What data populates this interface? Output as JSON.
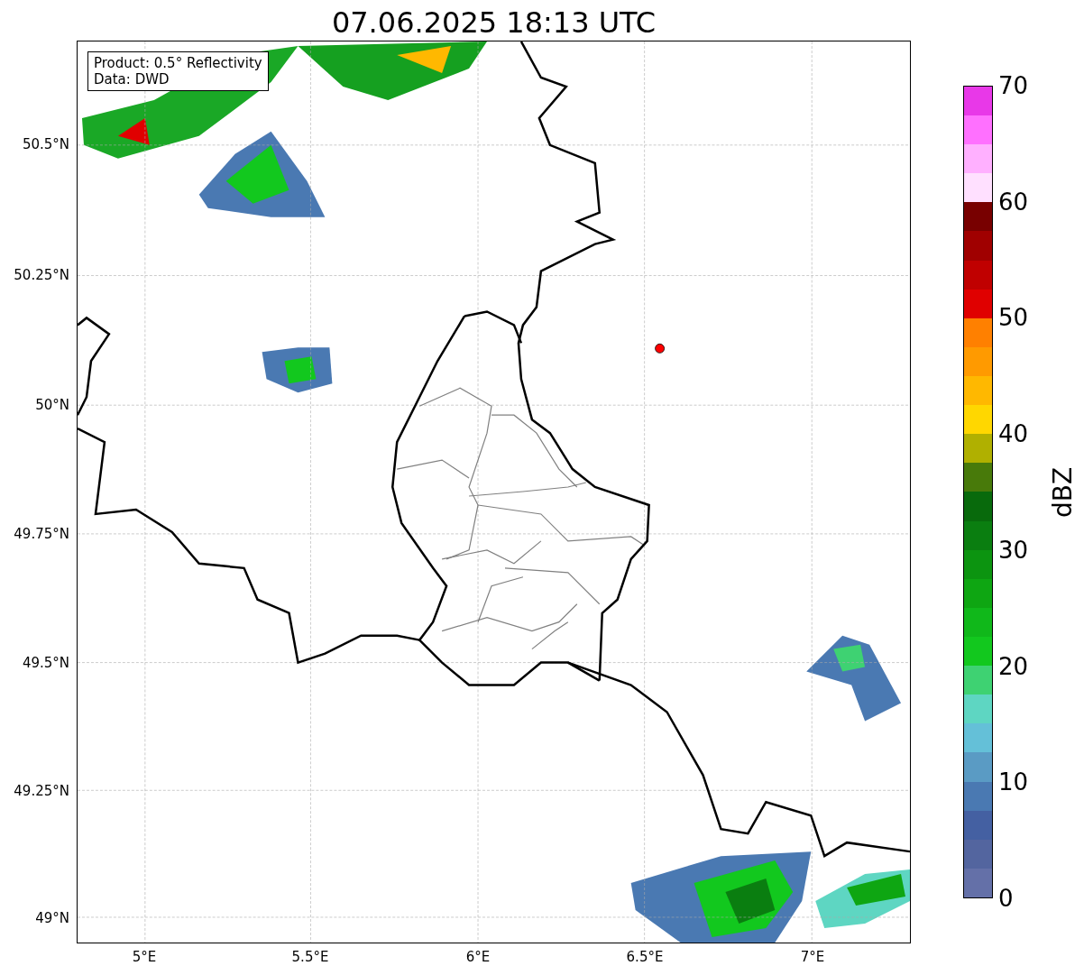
{
  "title": "07.06.2025 18:13 UTC",
  "legend": {
    "lines": [
      "Product: 0.5° Reflectivity",
      "Data: DWD"
    ]
  },
  "y_ticks": [
    "50.5°N",
    "50.25°N",
    "50°N",
    "49.75°N",
    "49.5°N",
    "49.25°N",
    "49°N"
  ],
  "x_ticks": [
    "5°E",
    "5.5°E",
    "6°E",
    "6.5°E",
    "7°E"
  ],
  "colorbar": {
    "label": "dBZ",
    "ticks": [
      "70",
      "60",
      "50",
      "40",
      "30",
      "20",
      "10",
      "0"
    ]
  }
}
